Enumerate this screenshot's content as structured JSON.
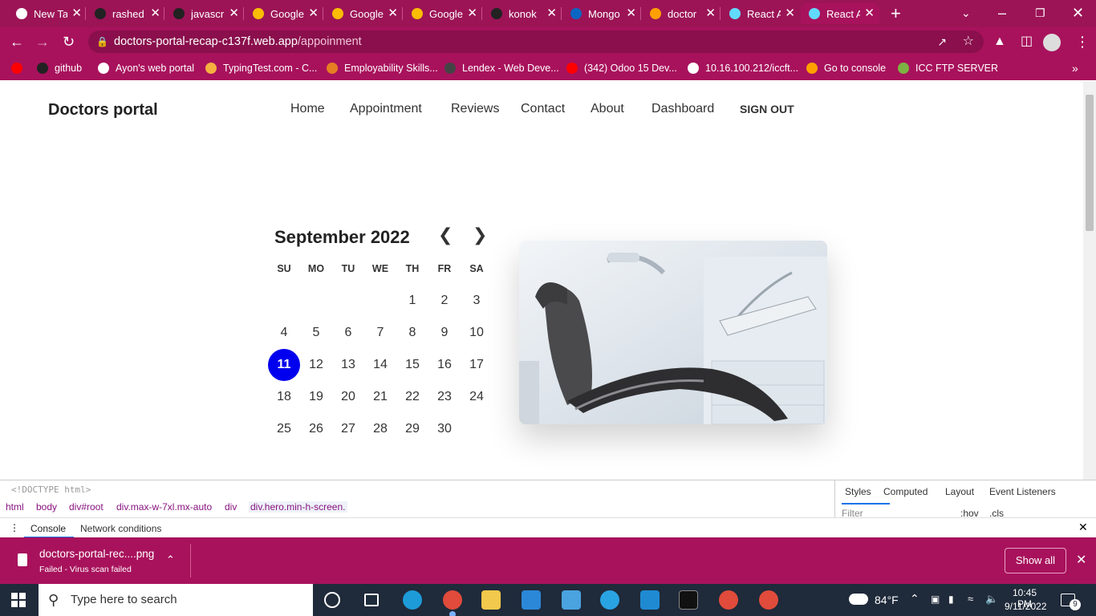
{
  "browser": {
    "tabs": [
      {
        "title": "New Tab",
        "icon": "chrome-icon",
        "color": "#ffffff"
      },
      {
        "title": "rashed",
        "icon": "github-icon",
        "color": "#222222"
      },
      {
        "title": "javascript",
        "icon": "github-icon",
        "color": "#222222"
      },
      {
        "title": "Google",
        "icon": "google-keep-icon",
        "color": "#fbbc04"
      },
      {
        "title": "Google",
        "icon": "google-keep-icon",
        "color": "#fbbc04"
      },
      {
        "title": "Google",
        "icon": "google-keep-icon",
        "color": "#fbbc04"
      },
      {
        "title": "konok",
        "icon": "github-icon",
        "color": "#222222"
      },
      {
        "title": "Mongo",
        "icon": "linkedin-icon",
        "color": "#0a66c2"
      },
      {
        "title": "doctor",
        "icon": "firebase-icon",
        "color": "#ffa000"
      },
      {
        "title": "React A",
        "icon": "react-icon",
        "color": "#61dafb"
      },
      {
        "title": "React A",
        "icon": "react-icon",
        "color": "#61dafb"
      }
    ],
    "url": {
      "host": "doctors-portal-recap-c137f.web.app",
      "path": "/appoinment"
    },
    "bookmarks": [
      {
        "label": "",
        "icon": "youtube-icon",
        "color": "#ff0000"
      },
      {
        "label": "github",
        "icon": "github-icon",
        "color": "#222222"
      },
      {
        "label": "Ayon's web portal",
        "icon": "globe-icon",
        "color": "#ffffff"
      },
      {
        "label": "TypingTest.com - C...",
        "icon": "typingtest-icon",
        "color": "#f5b041"
      },
      {
        "label": "Employability Skills...",
        "icon": "skills-icon",
        "color": "#e67e22"
      },
      {
        "label": "Lendex - Web Deve...",
        "icon": "lendex-icon",
        "color": "#444444"
      },
      {
        "label": "(342) Odoo 15 Dev...",
        "icon": "youtube-icon",
        "color": "#ff0000"
      },
      {
        "label": "10.16.100.212/iccft...",
        "icon": "globe-icon",
        "color": "#ffffff"
      },
      {
        "label": "Go to console",
        "icon": "firebase-icon",
        "color": "#ffa000"
      },
      {
        "label": "ICC FTP SERVER",
        "icon": "icc-icon",
        "color": "#7cb342"
      }
    ]
  },
  "site": {
    "brand": "Doctors portal",
    "nav": [
      "Home",
      "Appointment",
      "Reviews",
      "Contact",
      "About",
      "Dashboard"
    ],
    "signout": "SIGN OUT"
  },
  "calendar": {
    "month_label": "September 2022",
    "weekdays": [
      "SU",
      "MO",
      "TU",
      "WE",
      "TH",
      "FR",
      "SA"
    ],
    "first_weekday_index": 4,
    "days_in_month": 30,
    "selected_day": 11,
    "selected_color": "#0000ee"
  },
  "devtools": {
    "doctype": "<!DOCTYPE html>",
    "breadcrumbs": [
      "html",
      "body",
      "div#root",
      "div.max-w-7xl.mx-auto",
      "div",
      "div.hero.min-h-screen."
    ],
    "panel_tabs": [
      "Styles",
      "Computed",
      "Layout",
      "Event Listeners"
    ],
    "filter_placeholder": "Filter",
    "hov": ":hov",
    "cls": ".cls",
    "drawer_tabs": [
      "Console",
      "Network conditions"
    ]
  },
  "download": {
    "filename": "doctors-portal-rec....png",
    "status": "Failed - Virus scan failed",
    "show_all": "Show all"
  },
  "taskbar": {
    "search_placeholder": "Type here to search",
    "weather": "84°F",
    "time": "10:45 PM",
    "date": "9/11/2022",
    "notifications": "9"
  }
}
